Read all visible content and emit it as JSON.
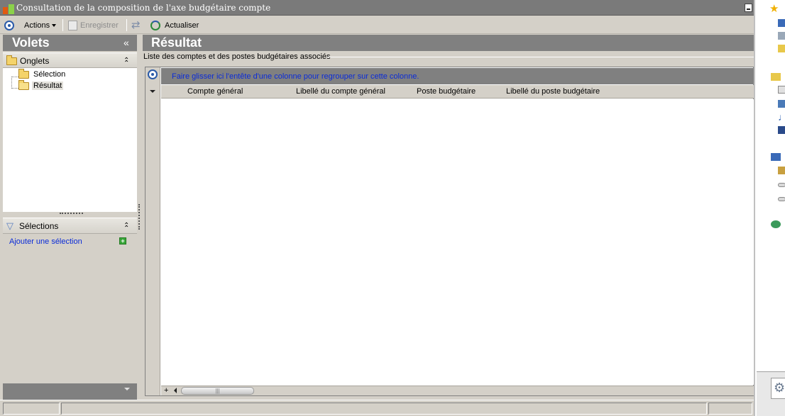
{
  "window": {
    "title": "Consultation de la composition de l'axe budgétaire compte"
  },
  "toolbar": {
    "actions_label": "Actions",
    "save_label": "Enregistrer",
    "refresh_label": "Actualiser"
  },
  "left_pane": {
    "title": "Volets",
    "collapse_glyph": "«",
    "onglets": {
      "title": "Onglets",
      "items": [
        {
          "label": "Sélection",
          "selected": false
        },
        {
          "label": "Résultat",
          "selected": true
        }
      ]
    },
    "selections": {
      "title": "Sélections",
      "add_link": "Ajouter une sélection"
    }
  },
  "main": {
    "title": "Résultat",
    "groupbox_label": "Liste des comptes et des postes budgétaires associés",
    "group_hint": "Faire glisser ici l'entête d'une colonne pour regrouper sur cette colonne.",
    "columns": [
      "Compte général",
      "Libellé du compte général",
      "Poste budgétaire",
      "Libellé du poste budgétaire"
    ],
    "rows": []
  },
  "colors": {
    "header_gray": "#808080",
    "link_blue": "#0a2bd8",
    "frame": "#d4d0c8"
  }
}
